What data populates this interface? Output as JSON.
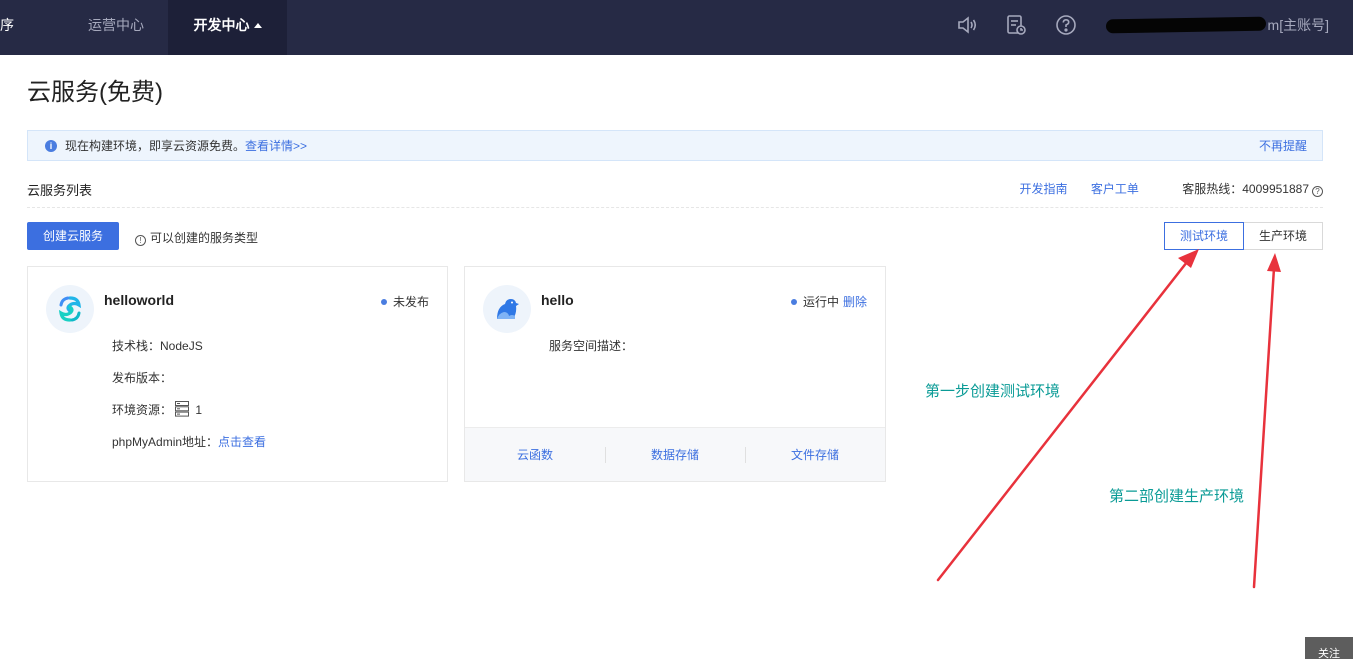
{
  "nav": {
    "left_cut": "序",
    "tab_ops": "运营中心",
    "tab_dev": "开发中心",
    "icons": [
      "volume-icon",
      "notification-doc-icon",
      "help-icon"
    ],
    "account_suffix": "m[主账号]"
  },
  "page": {
    "title": "云服务(免费)"
  },
  "notice": {
    "message": "现在构建环境，即享云资源免费。",
    "more_link": "查看详情>>",
    "dismiss": "不再提醒"
  },
  "list": {
    "title": "云服务列表",
    "dev_guide": "开发指南",
    "ticket": "客户工单",
    "hotline": "客服热线：4009951887",
    "create_button": "创建云服务",
    "types_hint": "可以创建的服务类型",
    "env_test": "测试环境",
    "env_prod": "生产环境"
  },
  "cards": [
    {
      "name": "helloworld",
      "status": "未发布",
      "fields": {
        "stack_label": "技术栈：",
        "stack_value": "NodeJS",
        "version_label": "发布版本：",
        "resource_label": "环境资源：",
        "resource_value": "1",
        "phpmyadmin_label": "phpMyAdmin地址：",
        "phpmyadmin_link": "点击查看"
      }
    },
    {
      "name": "hello",
      "status": "运行中",
      "delete": "删除",
      "desc_label": "服务空间描述：",
      "footer": [
        "云函数",
        "数据存储",
        "文件存储"
      ]
    }
  ],
  "annotations": {
    "step1": "第一步创建测试环境",
    "step2": "第二部创建生产环境"
  },
  "colors": {
    "nav_bg": "#262a45",
    "accent": "#3c6fe0",
    "annotation_text": "#0a9b96",
    "arrow": "#e8323c"
  },
  "follow_button": "关注"
}
